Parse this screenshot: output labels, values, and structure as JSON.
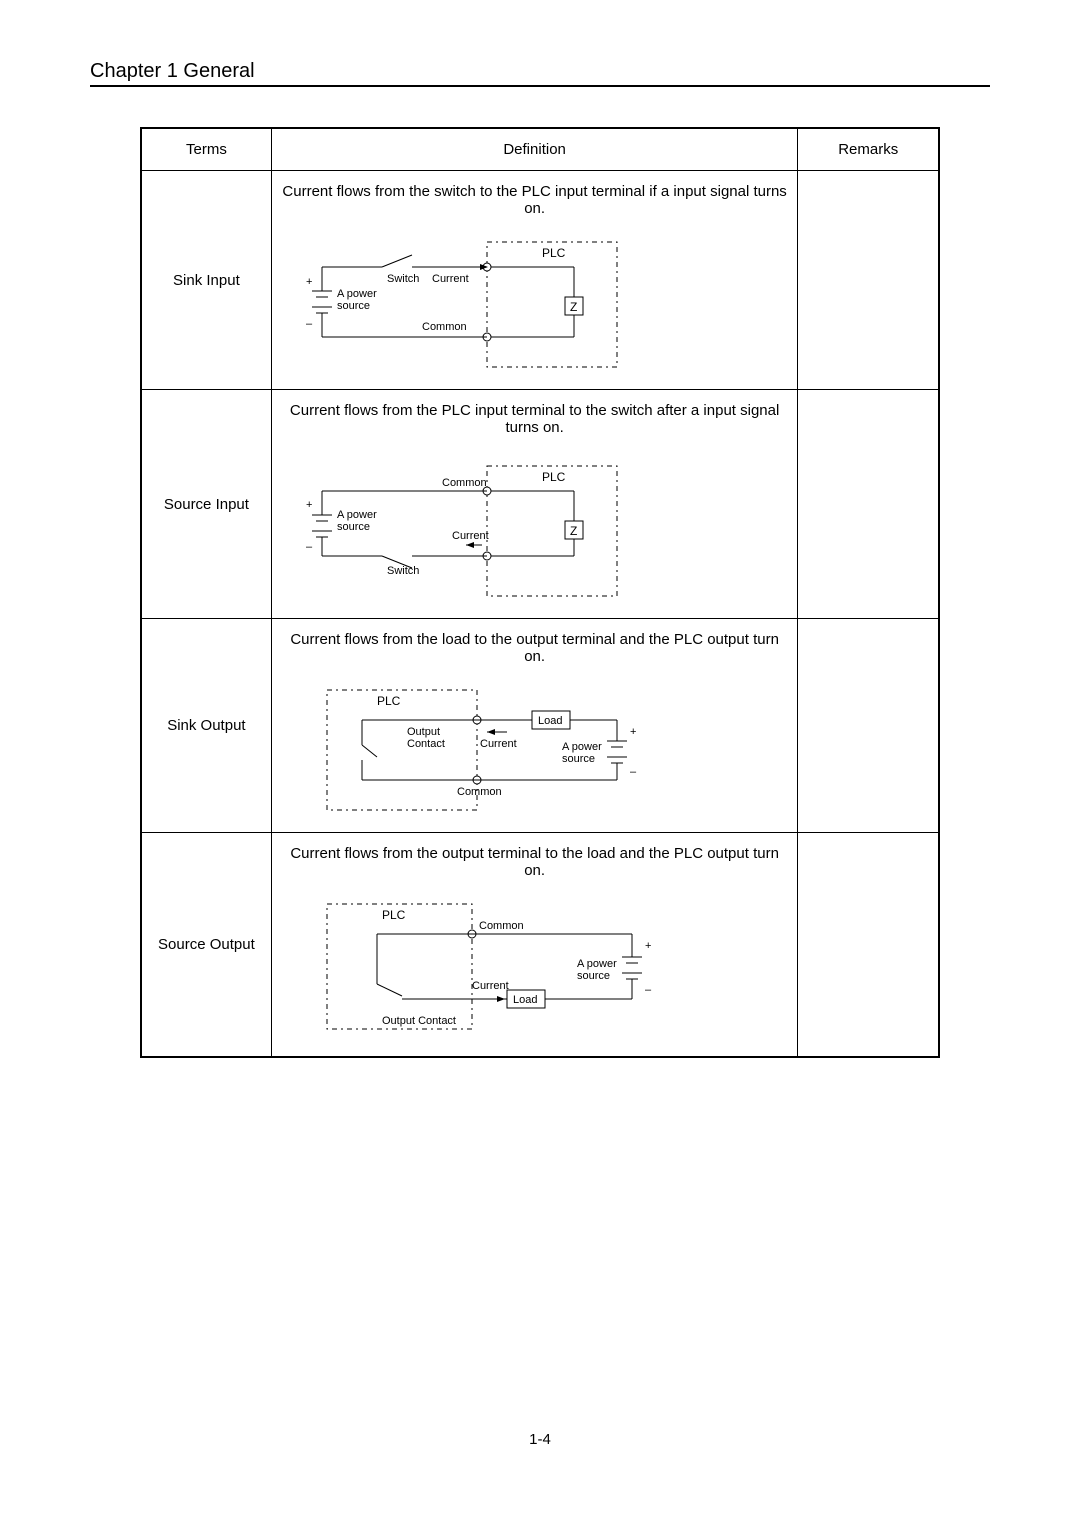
{
  "chapter_title": "Chapter 1   General",
  "page_number": "1-4",
  "table": {
    "headers": {
      "terms": "Terms",
      "definition": "Definition",
      "remarks": "Remarks"
    },
    "rows": [
      {
        "term": "Sink Input",
        "definition": "Current flows from the switch to the PLC input terminal if a input signal turns on.",
        "remarks": "",
        "diagram": {
          "plc": "PLC",
          "switch": "Switch",
          "current": "Current",
          "power1": "A power",
          "power2": "source",
          "common": "Common",
          "z": "Z",
          "plus": "+",
          "minus": "–"
        }
      },
      {
        "term": "Source Input",
        "definition": "Current flows from the PLC input terminal to the switch after a input signal turns on.",
        "remarks": "",
        "diagram": {
          "plc": "PLC",
          "switch": "Switch",
          "current": "Current",
          "power1": "A power",
          "power2": "source",
          "common": "Common",
          "z": "Z",
          "plus": "+",
          "minus": "–"
        }
      },
      {
        "term": "Sink Output",
        "definition": "Current flows from the load to the output terminal and the PLC output turn on.",
        "remarks": "",
        "diagram": {
          "plc": "PLC",
          "load": "Load",
          "output1": "Output",
          "output2": "Contact",
          "current": "Current",
          "power1": "A power",
          "power2": "source",
          "common": "Common",
          "plus": "+",
          "minus": "–"
        }
      },
      {
        "term": "Source Output",
        "definition": "Current flows from the output terminal to the load and the PLC output turn on.",
        "remarks": "",
        "diagram": {
          "plc": "PLC",
          "load": "Load",
          "output_contact": "Output Contact",
          "current": "Current",
          "power1": "A power",
          "power2": "source",
          "common": "Common",
          "plus": "+",
          "minus": "–"
        }
      }
    ]
  }
}
